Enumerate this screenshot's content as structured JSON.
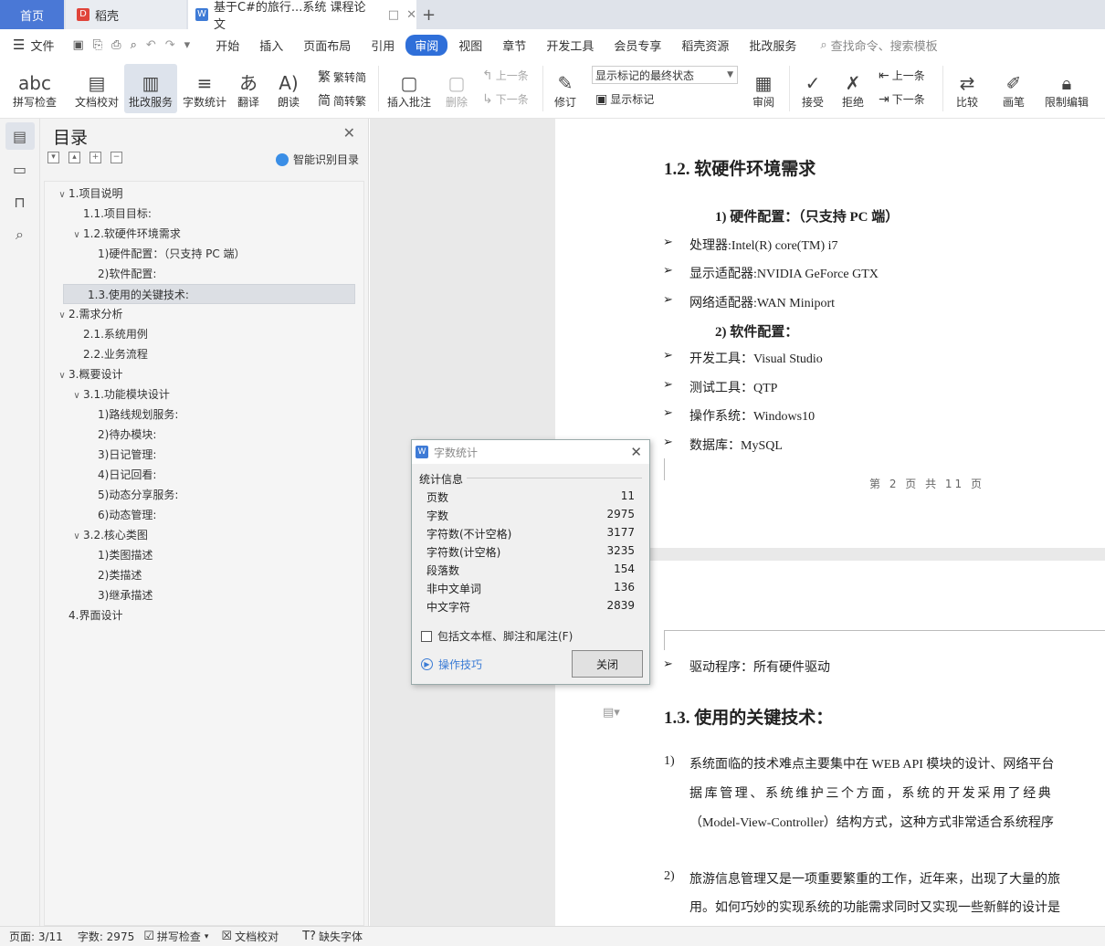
{
  "tabs": {
    "home": "首页",
    "daoke": "稻壳",
    "doc": "基于C#的旅行...系统 课程论文",
    "plus": "+"
  },
  "menu": {
    "file": "文件",
    "items": [
      "开始",
      "插入",
      "页面布局",
      "引用",
      "审阅",
      "视图",
      "章节",
      "开发工具",
      "会员专享",
      "稻壳资源",
      "批改服务"
    ],
    "active": "审阅",
    "search": "查找命令、搜索模板"
  },
  "toolbar": {
    "spell": "拼写检查",
    "doccheck": "文档校对",
    "review": "批改服务",
    "wordcount": "字数统计",
    "translate": "翻译",
    "read": "朗读",
    "trad": "繁转简",
    "simp": "简转繁",
    "insert_comment": "插入批注",
    "delete": "删除",
    "prev": "上一条",
    "next": "下一条",
    "revise": "修订",
    "markup_select": "显示标记的最终状态",
    "show_markup": "显示标记",
    "reviewer": "审阅",
    "accept": "接受",
    "reject": "拒绝",
    "prev2": "上一条",
    "next2": "下一条",
    "compare": "比较",
    "pen": "画笔",
    "restrict": "限制编辑"
  },
  "toc": {
    "title": "目录",
    "smart": "智能识别目录",
    "items": [
      {
        "text": "1.项目说明",
        "level": 0,
        "caret": "∨"
      },
      {
        "text": "1.1.项目目标:",
        "level": 1,
        "caret": ""
      },
      {
        "text": "1.2.软硬件环境需求",
        "level": 1,
        "caret": "∨"
      },
      {
        "text": "1)硬件配置：（只支持 PC 端）",
        "level": 2,
        "caret": ""
      },
      {
        "text": "2)软件配置:",
        "level": 2,
        "caret": ""
      },
      {
        "text": "1.3.使用的关键技术:",
        "level": 1,
        "caret": "",
        "selected": true
      },
      {
        "text": "2.需求分析",
        "level": 0,
        "caret": "∨"
      },
      {
        "text": "2.1.系统用例",
        "level": 1,
        "caret": ""
      },
      {
        "text": "2.2.业务流程",
        "level": 1,
        "caret": ""
      },
      {
        "text": "3.概要设计",
        "level": 0,
        "caret": "∨"
      },
      {
        "text": "3.1.功能模块设计",
        "level": 1,
        "caret": "∨"
      },
      {
        "text": "1)路线规划服务:",
        "level": 2,
        "caret": ""
      },
      {
        "text": "2)待办模块:",
        "level": 2,
        "caret": ""
      },
      {
        "text": "3)日记管理:",
        "level": 2,
        "caret": ""
      },
      {
        "text": "4)日记回看:",
        "level": 2,
        "caret": ""
      },
      {
        "text": "5)动态分享服务:",
        "level": 2,
        "caret": ""
      },
      {
        "text": "6)动态管理:",
        "level": 2,
        "caret": ""
      },
      {
        "text": "3.2.核心类图",
        "level": 1,
        "caret": "∨"
      },
      {
        "text": "1)类图描述",
        "level": 2,
        "caret": ""
      },
      {
        "text": "2)类描述",
        "level": 2,
        "caret": ""
      },
      {
        "text": "3)继承描述",
        "level": 2,
        "caret": ""
      },
      {
        "text": "4.界面设计",
        "level": 0,
        "caret": ""
      }
    ]
  },
  "doc": {
    "h12": "1.2. 软硬件环境需求",
    "hw_title": "1)   硬件配置：（只支持 PC 端）",
    "hw": [
      "处理器:Intel(R) core(TM) i7",
      "显示适配器:NVIDIA GeForce GTX",
      "网络适配器:WAN Miniport"
    ],
    "sw_title": "2)   软件配置：",
    "sw": [
      "开发工具：Visual Studio",
      "测试工具：QTP",
      "操作系统：Windows10",
      "数据库：MySQL"
    ],
    "page_num": "第 2 页 共 11 页",
    "driver": "驱动程序：所有硬件驱动",
    "h13": "1.3. 使用的关键技术：",
    "p1_num": "1)",
    "p1_lines": [
      "系统面临的技术难点主要集中在 WEB API 模块的设计、网络平台",
      "据库管理、系统维护三个方面，系统的开发采用了经典",
      "（Model-View-Controller）结构方式，这种方式非常适合系统程序"
    ],
    "p2_num": "2)",
    "p2_lines": [
      "旅游信息管理又是一项重要繁重的工作，近年来，出现了大量的旅",
      "用。如何巧妙的实现系统的功能需求同时又实现一些新鲜的设计是"
    ]
  },
  "dialog": {
    "title": "字数统计",
    "group": "统计信息",
    "stats": [
      {
        "label": "页数",
        "value": "11"
      },
      {
        "label": "字数",
        "value": "2975"
      },
      {
        "label": "字符数(不计空格)",
        "value": "3177"
      },
      {
        "label": "字符数(计空格)",
        "value": "3235"
      },
      {
        "label": "段落数",
        "value": "154"
      },
      {
        "label": "非中文单词",
        "value": "136"
      },
      {
        "label": "中文字符",
        "value": "2839"
      }
    ],
    "checkbox": "包括文本框、脚注和尾注(F)",
    "tips": "操作技巧",
    "close": "关闭"
  },
  "status": {
    "page": "页面: 3/11",
    "words": "字数: 2975",
    "spell": "拼写检查",
    "doccheck": "文档校对",
    "font": "缺失字体"
  }
}
